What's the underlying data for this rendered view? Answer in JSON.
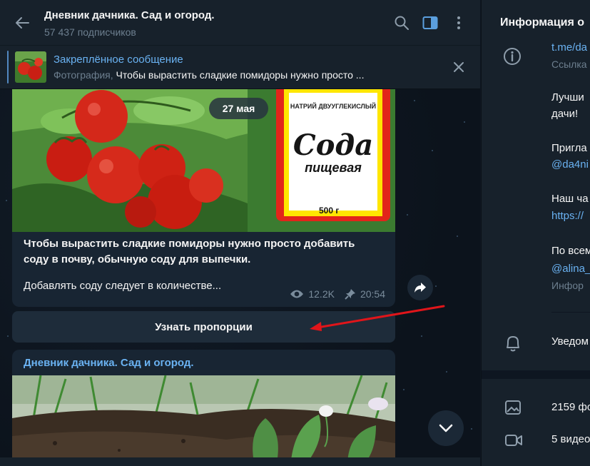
{
  "header": {
    "title": "Дневник дачника. Сад и огород.",
    "subscribers": "57 437 подписчиков"
  },
  "pinned": {
    "title": "Закреплённое сообщение",
    "kind": "Фотография,",
    "preview": "Чтобы вырастить сладкие помидоры нужно просто ..."
  },
  "message1": {
    "date": "27 мая",
    "image_text": {
      "brand_top": "НАТРИЙ ДВУУГЛЕКИСЛЫЙ",
      "word1": "Сода",
      "word2": "пищевая",
      "weight": "500 г"
    },
    "text_line1": "Чтобы вырастить сладкие помидоры нужно просто добавить",
    "text_line2": "соду в почву, обычную соду для выпечки.",
    "text_more": "Добавлять соду следует в количестве...",
    "views": "12.2K",
    "time": "20:54"
  },
  "inline_button": {
    "label": "Узнать пропорции"
  },
  "message2": {
    "author": "Дневник дачника. Сад и огород."
  },
  "info": {
    "title": "Информация о",
    "link_short": "t.me/da",
    "link_caption": "Ссылка",
    "desc1": "Лучши",
    "desc2": "дачи!",
    "invite": "Пригла",
    "invite_handle": "@da4ni",
    "chat": "Наш ча",
    "chat_link": "https://",
    "contact": "По всем",
    "contact_handle": "@alina_",
    "contact_caption": "Инфор",
    "notifications": "Уведом",
    "photos": "2159 фо",
    "videos": "5 видео"
  },
  "colors": {
    "accent": "#6ab2f2",
    "panel": "#17212b",
    "bubble": "#182533",
    "arrow": "#e0151a"
  }
}
